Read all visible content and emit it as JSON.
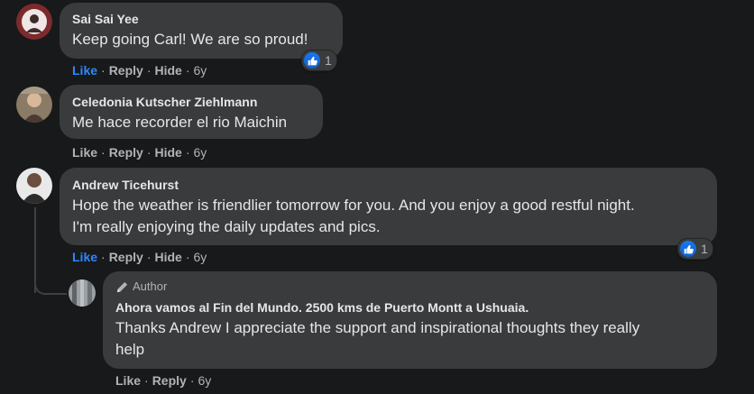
{
  "comments": [
    {
      "name": "Sai Sai Yee",
      "text": "Keep going Carl! We are so proud!",
      "actions": {
        "like": "Like",
        "reply": "Reply",
        "hide": "Hide",
        "time": "6y"
      },
      "reactions": "1"
    },
    {
      "name": "Celedonia Kutscher Ziehlmann",
      "text": "Me hace recorder el rio Maichin",
      "actions": {
        "like": "Like",
        "reply": "Reply",
        "hide": "Hide",
        "time": "6y"
      }
    },
    {
      "name": "Andrew Ticehurst",
      "text_line1": "Hope the weather is friendlier tomorrow for you. And you enjoy a good restful night.",
      "text_line2": "I'm really enjoying the daily updates and pics.",
      "actions": {
        "like": "Like",
        "reply": "Reply",
        "hide": "Hide",
        "time": "6y"
      },
      "reactions": "1"
    }
  ],
  "reply": {
    "author_tag": "Author",
    "name": "Ahora vamos al Fin del Mundo. 2500 kms de Puerto Montt a Ushuaia.",
    "text_line1": "Thanks Andrew I appreciate the support and inspirational thoughts they really",
    "text_line2": "help",
    "actions": {
      "like": "Like",
      "reply": "Reply",
      "time": "6y"
    }
  },
  "colors": {
    "background": "#18191a",
    "bubble": "#3a3b3c",
    "link_active": "#2d88ff",
    "muted": "#b0b3b8"
  }
}
